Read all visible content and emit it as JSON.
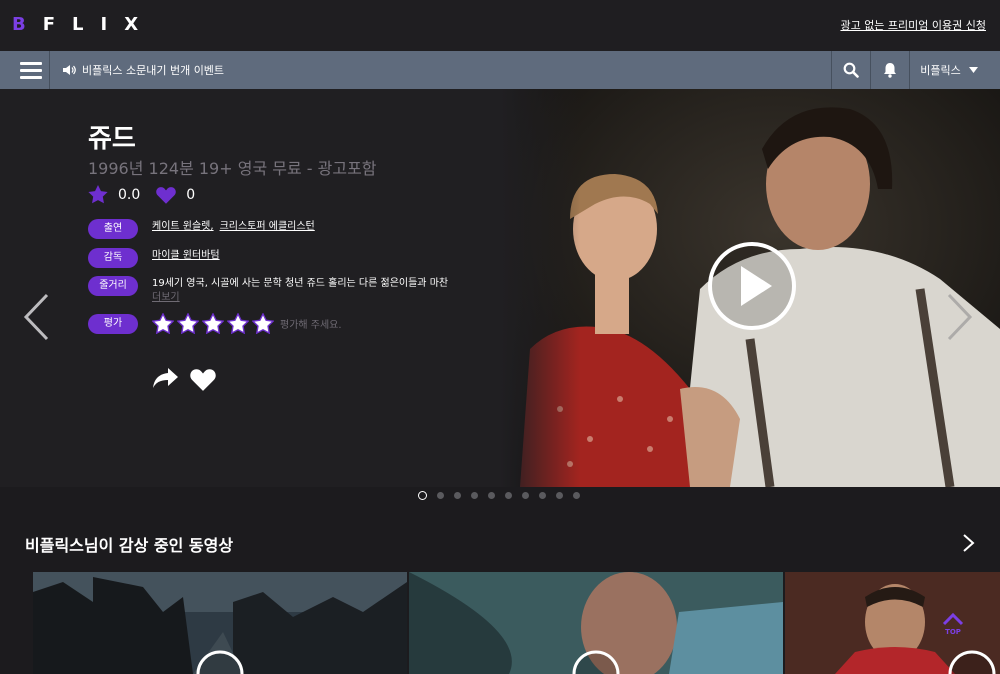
{
  "header": {
    "logo_b": "B",
    "logo_rest": "FLIX",
    "promo_link": "광고 없는 프리미엄 이용권 신청"
  },
  "nav": {
    "notice": "비플릭스 소문내기 번개 이벤트",
    "user_label": "비플릭스"
  },
  "hero": {
    "title": "쥬드",
    "meta": "1996년  124분  19+  영국  무료 - 광고포함",
    "star_score": "0.0",
    "like_count": "0",
    "cast_tag": "출연",
    "cast_1": "케이트 윈슬렛,",
    "cast_2": "크리스토퍼 에클리스턴",
    "director_tag": "감독",
    "director": "마이클 윈터바텀",
    "plot_tag": "줄거리",
    "plot": "19세기 영국, 시골에 사는 문학 청년 쥬드 홀리는 다른 젊은이들과 마찬",
    "more": "더보기",
    "rate_tag": "평가",
    "rate_hint": "평가해 주세요.",
    "rate_stars": 0
  },
  "carousel": {
    "total": 10,
    "active": 1
  },
  "section": {
    "title": "비플릭스님이 감상 중인 동영상"
  },
  "top_button": "TOP",
  "colors": {
    "accent": "#6e2fcf",
    "nav": "#5f6b7d"
  }
}
